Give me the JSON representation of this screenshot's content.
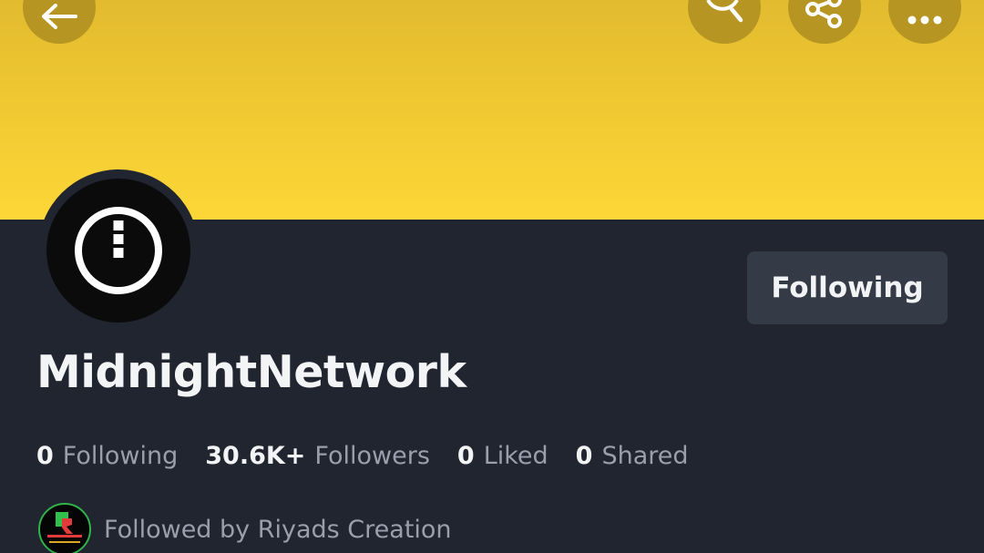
{
  "header": {
    "banner_color": "#f5cd33",
    "buttons": [
      {
        "name": "back",
        "icon": "arrow-left-icon"
      },
      {
        "name": "search",
        "icon": "search-icon"
      },
      {
        "name": "share",
        "icon": "share-icon"
      },
      {
        "name": "more",
        "icon": "more-horizontal-icon"
      }
    ]
  },
  "profile": {
    "avatar_icon": "info-circle-icon",
    "follow_button_label": "Following",
    "username": "MidnightNetwork"
  },
  "stats": {
    "following_count": "0",
    "following_label": "Following",
    "followers_count": "30.6K+",
    "followers_label": "Followers",
    "liked_count": "0",
    "liked_label": "Liked",
    "shared_count": "0",
    "shared_label": "Shared"
  },
  "followed_by": {
    "text": "Followed by Riyads Creation",
    "avatar_icon": "riyads-creation-avatar"
  },
  "colors": {
    "background": "#212530",
    "button_bg": "#353a47",
    "text_primary": "#f2f3f5",
    "text_secondary": "#9a9fab"
  }
}
